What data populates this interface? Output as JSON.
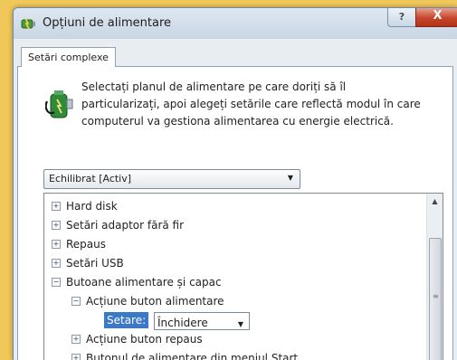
{
  "window": {
    "title": "Opțiuni de alimentare",
    "help_label": "?",
    "close_label": "X"
  },
  "tab": {
    "label": "Setări complexe"
  },
  "description": {
    "line1": "Selectați planul de alimentare pe care doriți să îl",
    "line2": "particularizați, apoi alegeți setările care reflectă modul în care",
    "line3": "computerul va gestiona alimentarea cu energie electrică."
  },
  "plan_select": {
    "value": "Echilibrat [Activ]"
  },
  "tree": {
    "items": [
      {
        "label": "Hard disk",
        "expander": "+"
      },
      {
        "label": "Setări adaptor fără fir",
        "expander": "+"
      },
      {
        "label": "Repaus",
        "expander": "+"
      },
      {
        "label": "Setări USB",
        "expander": "+"
      },
      {
        "label": "Butoane alimentare și capac",
        "expander": "−"
      },
      {
        "label": "Acțiune buton alimentare",
        "expander": "−"
      },
      {
        "label": "Acțiune buton repaus",
        "expander": "+"
      },
      {
        "label": "Butonul de alimentare din meniul Start",
        "expander": "+"
      }
    ],
    "setting": {
      "label": "Setare:",
      "value": "Închidere"
    }
  },
  "icons": {
    "window_icon": "power-options-icon",
    "plan_icon": "power-plug-battery-icon",
    "dropdown": "chevron-down-icon"
  },
  "colors": {
    "background": "#f0c85a",
    "selection": "#3b78c8",
    "close_button": "#c6452b"
  }
}
